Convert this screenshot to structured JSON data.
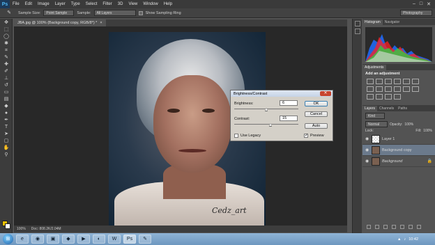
{
  "app": {
    "logo_text": "Ps"
  },
  "menu": {
    "items": [
      "File",
      "Edit",
      "Image",
      "Layer",
      "Type",
      "Select",
      "Filter",
      "3D",
      "View",
      "Window",
      "Help"
    ],
    "window_controls": [
      "–",
      "□",
      "✕"
    ]
  },
  "options": {
    "sample_size_label": "Sample Size:",
    "sample_size_value": "Point Sample",
    "sample_label": "Sample:",
    "sample_value": "All Layers",
    "show_ring_label": "Show Sampling Ring",
    "workspace": "Photography"
  },
  "document": {
    "tab_title": "JBA.jpg @ 100% (Background copy, RGB/8*) *",
    "close_glyph": "×",
    "signature": "Cedz_art",
    "zoom": "100%",
    "doc_size": "Doc: 808.2K/2.04M"
  },
  "panels": {
    "histogram_tab": "Histogram",
    "navigator_tab": "Navigator",
    "adjustments_tab": "Adjustments",
    "add_adjustment": "Add an adjustment",
    "layers_tab": "Layers",
    "channels_tab": "Channels",
    "paths_tab": "Paths",
    "kind_label": "Kind",
    "blend_mode": "Normal",
    "opacity_label": "Opacity:",
    "opacity_value": "100%",
    "lock_label": "Lock:",
    "fill_label": "Fill:",
    "fill_value": "100%",
    "layers": [
      {
        "name": "Layer 1"
      },
      {
        "name": "Background copy"
      },
      {
        "name": "Background"
      }
    ]
  },
  "dialog": {
    "title": "Brightness/Contrast",
    "close_glyph": "✕",
    "brightness_label": "Brightness:",
    "brightness_value": "6",
    "contrast_label": "Contrast:",
    "contrast_value": "15",
    "legacy_label": "Use Legacy",
    "preview_label": "Preview",
    "ok": "OK",
    "cancel": "Cancel",
    "auto": "Auto"
  },
  "taskbar": {
    "start_glyph": "⊞",
    "clock": "10:42",
    "apps": [
      "e",
      "◉",
      "▣",
      "◆",
      "▶",
      "◐",
      "W",
      "Ps",
      "✎"
    ]
  },
  "colors": {
    "foreground": "#f2c200",
    "background": "#ffffff",
    "selected_layer": "#6b7a8c"
  }
}
